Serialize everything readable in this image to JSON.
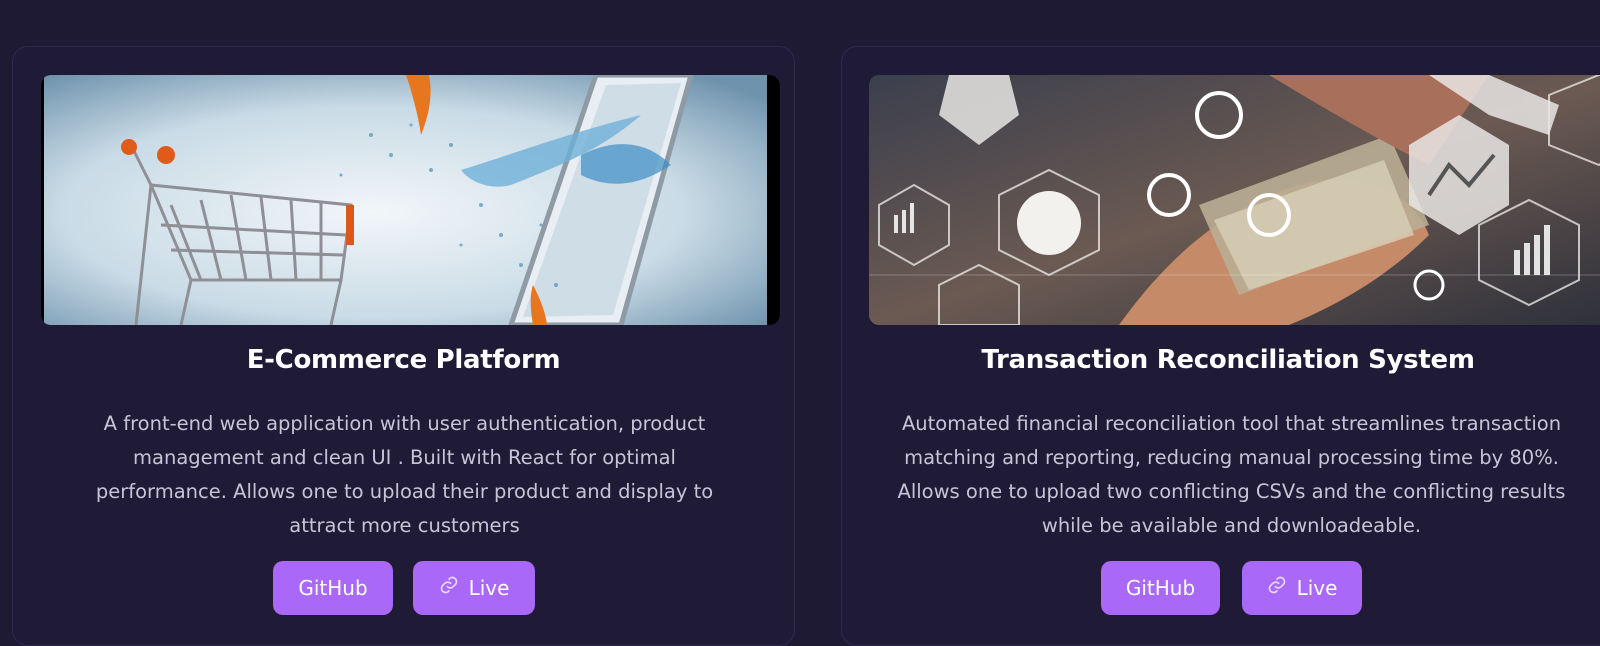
{
  "projects": [
    {
      "title": "E-Commerce Platform",
      "image_alt": "shopping cart and splashing water from phone screen",
      "description": "A front-end web application with user authentication, product management and clean UI . Built with React for optimal performance. Allows one to upload their product and display to attract more customers",
      "github_label": "GitHub",
      "live_label": "Live"
    },
    {
      "title": "Transaction Reconciliation System",
      "image_alt": "hands with cash and finance icons overlay",
      "description": "Automated financial reconciliation tool that streamlines transaction matching and reporting, reducing manual processing time by 80%. Allows one to upload two conflicting CSVs and the conflicting results while be available and downloadeable.",
      "github_label": "GitHub",
      "live_label": "Live"
    }
  ],
  "colors": {
    "background": "#1e1a33",
    "card": "#1f1a36",
    "button": "#a968f8",
    "description_text": "#c8c4d8"
  },
  "icons": {
    "live_icon": "link-icon"
  }
}
